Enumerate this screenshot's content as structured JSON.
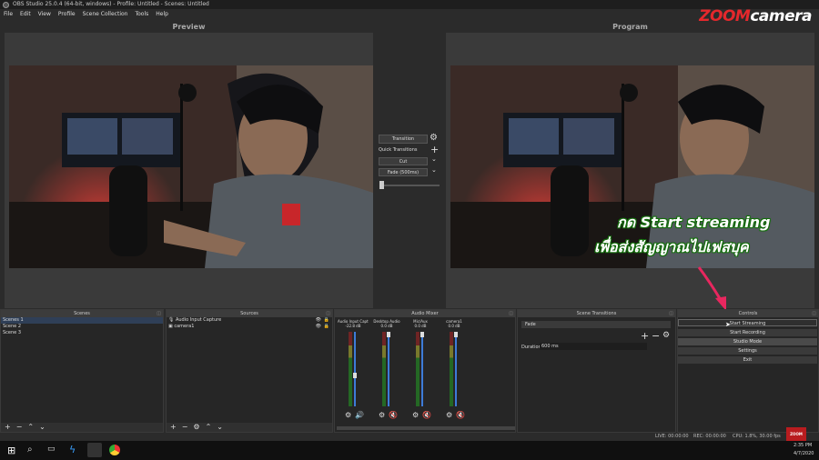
{
  "window": {
    "title": "OBS Studio 25.0.4 (64-bit, windows) - Profile: Untitled - Scenes: Untitled"
  },
  "menu": [
    "File",
    "Edit",
    "View",
    "Profile",
    "Scene Collection",
    "Tools",
    "Help"
  ],
  "brand": {
    "zoom": "ZOOM",
    "camera": "camera"
  },
  "preview": {
    "label": "Preview"
  },
  "program": {
    "label": "Program"
  },
  "transitions_center": {
    "transition_button": "Transition",
    "quick_label": "Quick Transitions",
    "cut": "Cut",
    "fade": "Fade (500ms)"
  },
  "overlay": {
    "line1": "กด Start streaming",
    "line2": "เพื่อส่งสัญญาณไปเฟสบุค"
  },
  "scenes": {
    "header": "Scenes",
    "items": [
      "Scenes 1",
      "Scene 2",
      "Scene 3"
    ]
  },
  "sources": {
    "header": "Sources",
    "items": [
      "Audio Input Capture",
      "camera1"
    ]
  },
  "mixer": {
    "header": "Audio Mixer",
    "channels": [
      {
        "name": "Audio Input Capture",
        "db": "-22.8 dB",
        "level": 0.55
      },
      {
        "name": "Desktop Audio",
        "db": "0.0 dB",
        "level": 0.0
      },
      {
        "name": "Mic/Aux",
        "db": "0.0 dB",
        "level": 0.0
      },
      {
        "name": "camera1",
        "db": "0.0 dB",
        "level": 0.0
      }
    ]
  },
  "scene_transitions": {
    "header": "Scene Transitions",
    "type": "Fade",
    "duration_label": "Duration",
    "duration_value": "600 ms"
  },
  "controls": {
    "header": "Controls",
    "start_streaming": "Start Streaming",
    "start_recording": "Start Recording",
    "studio_mode": "Studio Mode",
    "settings": "Settings",
    "exit": "Exit"
  },
  "status": {
    "live": "LIVE: 00:00:00",
    "rec": "REC: 00:00:00",
    "cpu": "CPU: 1.8%, 30.00 fps"
  },
  "taskbar": {
    "time": "2:35 PM",
    "date": "4/7/2020"
  },
  "colors": {
    "accent_red": "#e5282c",
    "overlay_green": "#177a0e",
    "arrow_pink": "#e8275f"
  }
}
